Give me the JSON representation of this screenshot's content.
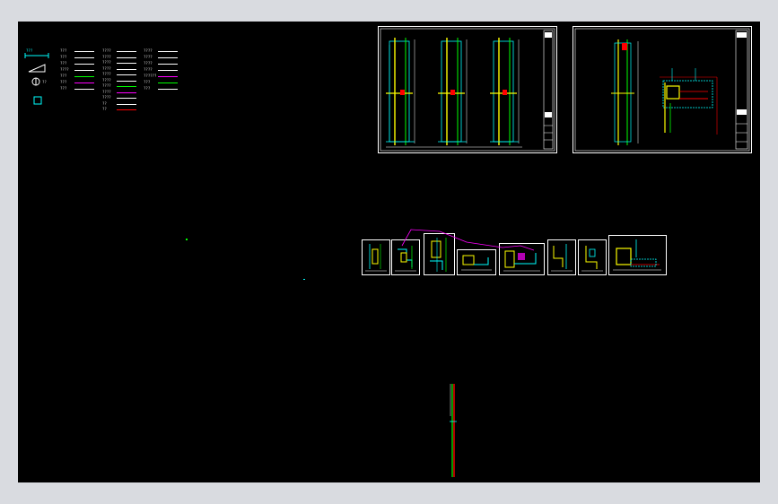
{
  "legend": {
    "scale_label": "???",
    "symbol_label": "??",
    "line_rows": [
      {
        "label": "???",
        "color": "#ffffff"
      },
      {
        "label": "???",
        "color": "#ffffff"
      },
      {
        "label": "???",
        "color": "#ffffff"
      },
      {
        "label": "????",
        "color": "#ffffff"
      },
      {
        "label": "???",
        "color": "#00ff00"
      },
      {
        "label": "???",
        "color": "#ff00ff"
      },
      {
        "label": "???",
        "color": "#ffffff"
      }
    ],
    "col2_rows": [
      {
        "label": "????",
        "color": "#ffffff"
      },
      {
        "label": "????",
        "color": "#ffffff"
      },
      {
        "label": "????",
        "color": "#ffffff"
      },
      {
        "label": "????",
        "color": "#ffffff"
      },
      {
        "label": "????",
        "color": "#ffffff"
      },
      {
        "label": "????",
        "color": "#ffffff"
      },
      {
        "label": "????",
        "color": "#00ff00"
      },
      {
        "label": "????",
        "color": "#ff00ff"
      },
      {
        "label": "????",
        "color": "#ffffff"
      },
      {
        "label": "??",
        "color": "#ffffff"
      },
      {
        "label": "??",
        "color": "#ff0000"
      }
    ],
    "col3_rows": [
      {
        "label": "????",
        "color": "#ffffff"
      },
      {
        "label": "????",
        "color": "#ffffff"
      },
      {
        "label": "????",
        "color": "#ffffff"
      },
      {
        "label": "????",
        "color": "#ffffff"
      },
      {
        "label": "??????",
        "color": "#ff00ff"
      },
      {
        "label": "???",
        "color": "#00ff00"
      },
      {
        "label": "???",
        "color": "#ffffff"
      }
    ]
  },
  "colors": {
    "background": "#000000",
    "frame": "#d9dbe0",
    "cyan": "#00ffff",
    "yellow": "#ffff00",
    "green": "#00ff00",
    "red": "#ff0000",
    "magenta": "#ff00ff",
    "white": "#ffffff"
  }
}
